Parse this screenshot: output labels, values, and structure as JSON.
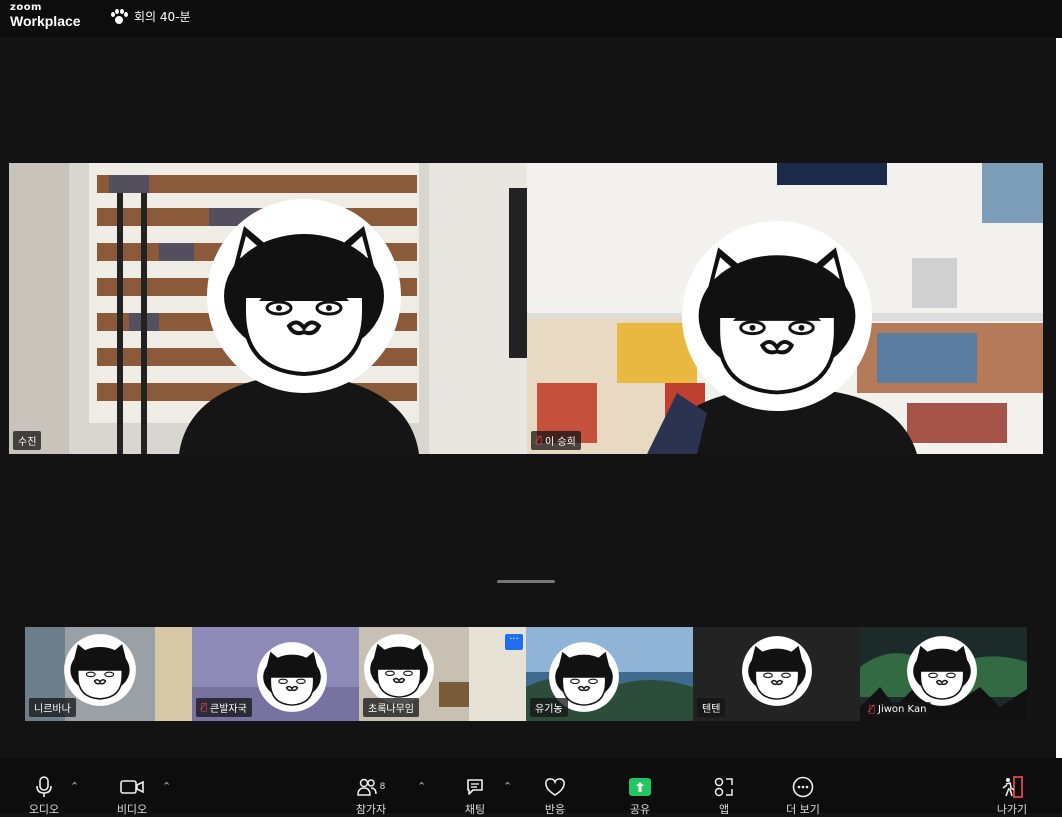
{
  "app": {
    "logo_small": "zoom",
    "logo_big": "Workplace",
    "meeting_title": "회의 40-분"
  },
  "main_tiles": [
    {
      "name": "수진",
      "muted": false,
      "active": true
    },
    {
      "name": "이 승희",
      "muted": true,
      "active": false
    }
  ],
  "strip_tiles": [
    {
      "name": "니르바나",
      "muted": false
    },
    {
      "name": "큰발자국",
      "muted": true
    },
    {
      "name": "초록나무임",
      "muted": false
    },
    {
      "name": "유기농",
      "muted": false
    },
    {
      "name": "텐텐",
      "muted": false
    },
    {
      "name": "Jiwon Kan",
      "muted": true
    }
  ],
  "more_badge": "···",
  "toolbar": {
    "audio": "오디오",
    "video": "비디오",
    "participants": "참가자",
    "participants_count": "8",
    "chat": "채팅",
    "reactions": "반응",
    "share": "공유",
    "apps": "앱",
    "more": "더 보기",
    "leave": "나가기"
  },
  "icons": [
    "paw-icon",
    "microphone-icon",
    "video-camera-icon",
    "participants-icon",
    "chat-icon",
    "heart-icon",
    "share-screen-icon",
    "apps-icon",
    "more-icon",
    "leave-icon",
    "mic-muted-icon"
  ],
  "colors": {
    "active_border": "#3ccf72",
    "share_green": "#22c560",
    "muted_red": "#e0464e",
    "badge_blue": "#1f6ff0"
  }
}
